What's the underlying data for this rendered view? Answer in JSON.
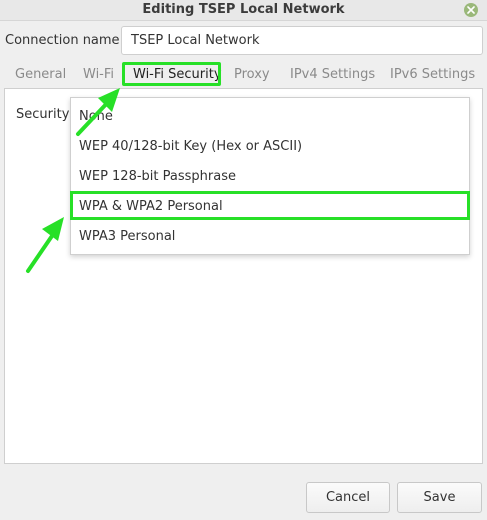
{
  "window": {
    "title": "Editing TSEP Local Network"
  },
  "connection": {
    "label": "Connection name",
    "value": "TSEP Local Network"
  },
  "tabs": [
    {
      "label": "General"
    },
    {
      "label": "Wi-Fi"
    },
    {
      "label": "Wi-Fi Security"
    },
    {
      "label": "Proxy"
    },
    {
      "label": "IPv4 Settings"
    },
    {
      "label": "IPv6 Settings"
    }
  ],
  "security": {
    "label": "Security",
    "options": [
      {
        "label": "None"
      },
      {
        "label": "WEP 40/128-bit Key (Hex or ASCII)"
      },
      {
        "label": "WEP 128-bit Passphrase"
      },
      {
        "label": "WPA & WPA2 Personal"
      },
      {
        "label": "WPA3 Personal"
      }
    ]
  },
  "buttons": {
    "cancel": "Cancel",
    "save": "Save"
  },
  "colors": {
    "annotation": "#27e027",
    "close_button": "#9ab87a"
  }
}
